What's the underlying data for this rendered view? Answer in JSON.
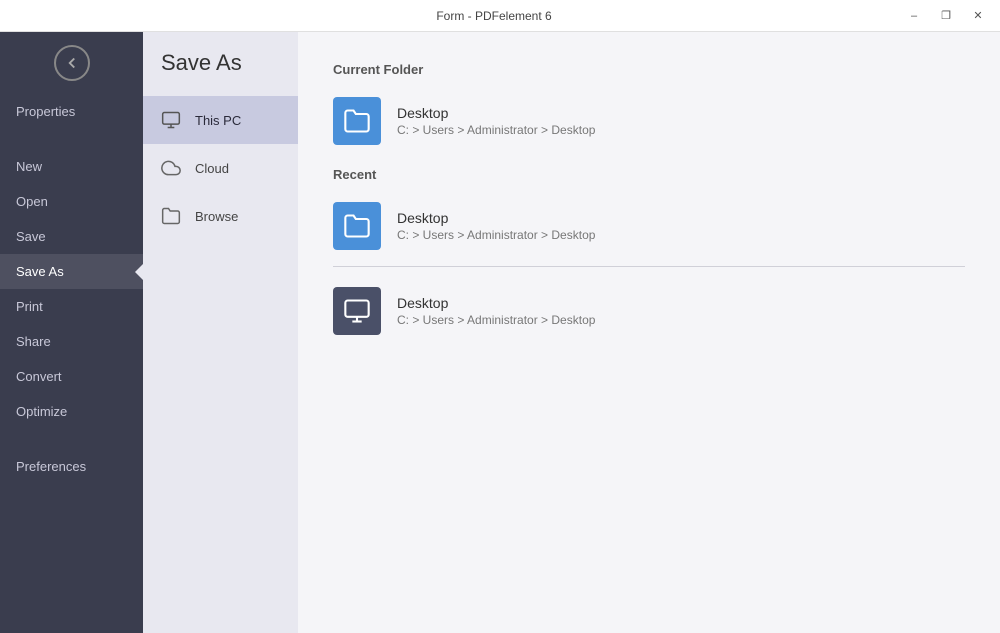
{
  "titleBar": {
    "title": "Form - PDFelement 6",
    "minimizeLabel": "–",
    "restoreLabel": "❐",
    "closeLabel": "✕"
  },
  "sidebar": {
    "backLabel": "‹",
    "items": [
      {
        "id": "properties",
        "label": "Properties",
        "active": false
      },
      {
        "id": "new",
        "label": "New",
        "active": false
      },
      {
        "id": "open",
        "label": "Open",
        "active": false
      },
      {
        "id": "save",
        "label": "Save",
        "active": false
      },
      {
        "id": "save-as",
        "label": "Save As",
        "active": true
      },
      {
        "id": "print",
        "label": "Print",
        "active": false
      },
      {
        "id": "share",
        "label": "Share",
        "active": false
      },
      {
        "id": "convert",
        "label": "Convert",
        "active": false
      },
      {
        "id": "optimize",
        "label": "Optimize",
        "active": false
      },
      {
        "id": "preferences",
        "label": "Preferences",
        "active": false
      }
    ]
  },
  "savePanel": {
    "title": "Save As",
    "navItems": [
      {
        "id": "this-pc",
        "label": "This PC",
        "active": true
      },
      {
        "id": "cloud",
        "label": "Cloud",
        "active": false
      },
      {
        "id": "browse",
        "label": "Browse",
        "active": false
      }
    ]
  },
  "mainContent": {
    "currentFolderLabel": "Current Folder",
    "recentLabel": "Recent",
    "currentFolder": {
      "name": "Desktop",
      "path": "C: > Users > Administrator > Desktop",
      "iconType": "blue"
    },
    "recentItems": [
      {
        "name": "Desktop",
        "path": "C: > Users > Administrator > Desktop",
        "iconType": "blue"
      },
      {
        "name": "Desktop",
        "path": "C: > Users > Administrator > Desktop",
        "iconType": "dark"
      }
    ]
  }
}
